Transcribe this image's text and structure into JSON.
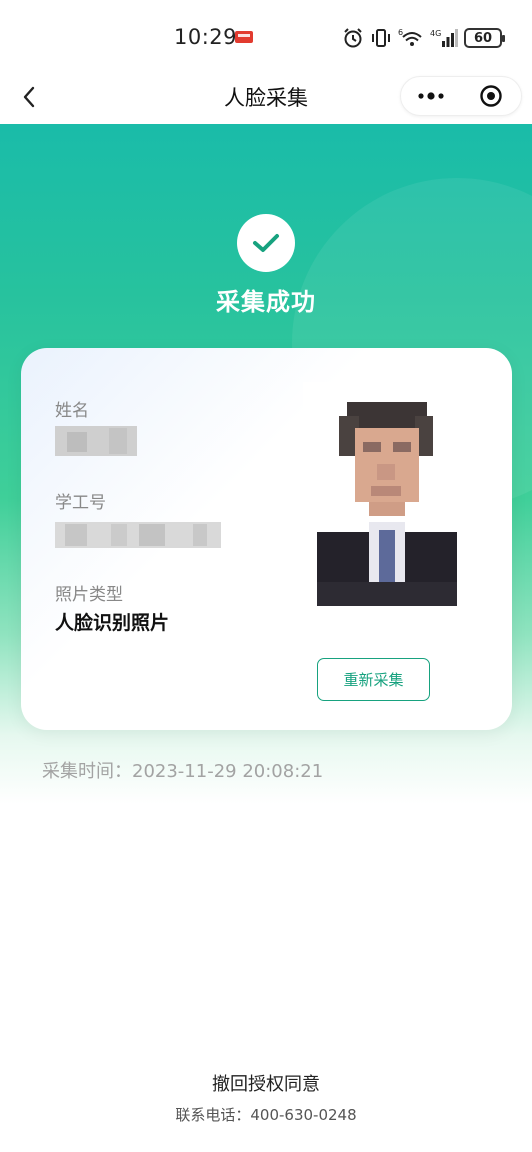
{
  "status_bar": {
    "time": "10:29",
    "network": "4G",
    "battery": "60"
  },
  "nav": {
    "title": "人脸采集"
  },
  "result": {
    "title": "采集成功"
  },
  "card": {
    "name_label": "姓名",
    "id_label": "学工号",
    "photo_type_label": "照片类型",
    "photo_type_value": "人脸识别照片",
    "recapture_label": "重新采集"
  },
  "capture_time": "采集时间：2023-11-29 20:08:21",
  "footer": {
    "revoke_label": "撤回授权同意",
    "contact": "联系电话：400-630-0248"
  },
  "colors": {
    "accent": "#17a27f",
    "hero_top": "#1abca9",
    "hero_mid": "#3fcf99"
  }
}
